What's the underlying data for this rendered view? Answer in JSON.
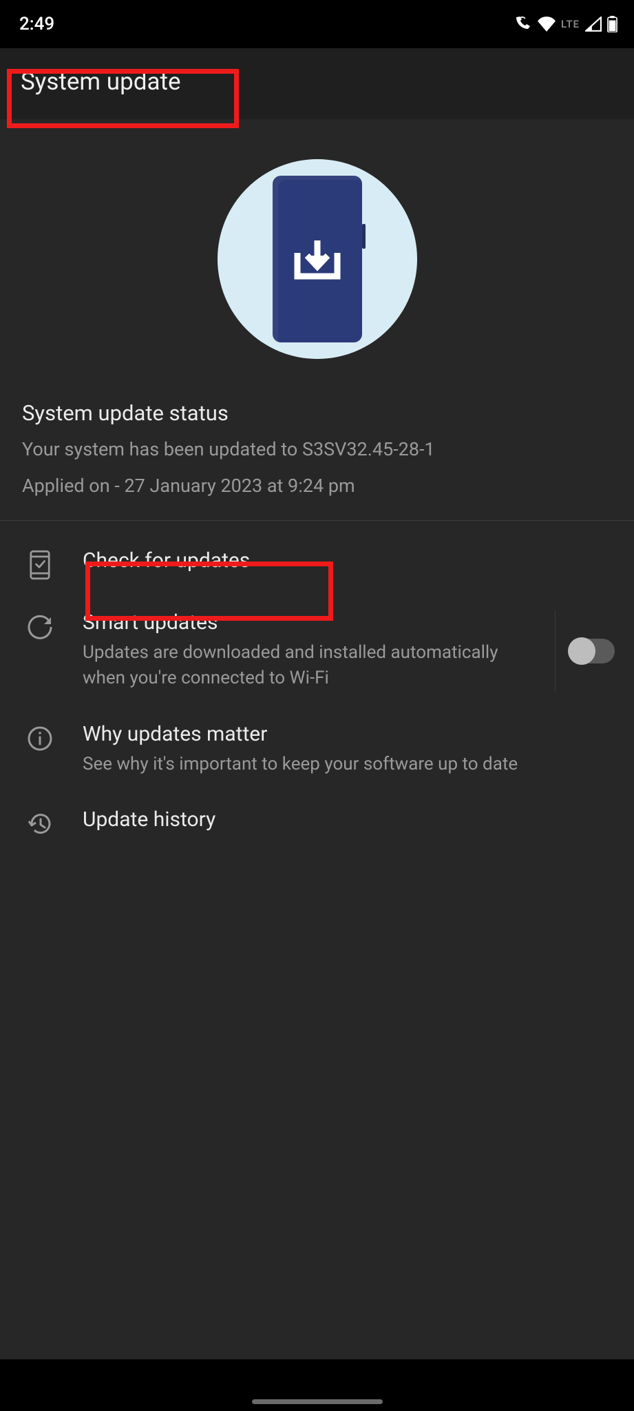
{
  "status_bar": {
    "time": "2:49",
    "network_type": "LTE"
  },
  "header": {
    "title": "System update"
  },
  "status_block": {
    "title": "System update status",
    "line1": "Your system has been updated to S3SV32.45-28-1",
    "line2": "Applied on - 27 January 2023 at 9:24 pm"
  },
  "rows": {
    "check": {
      "title": "Check for updates"
    },
    "smart": {
      "title": "Smart updates",
      "sub": "Updates are downloaded and installed automatically when you're connected to Wi-Fi",
      "enabled": false
    },
    "why": {
      "title": "Why updates matter",
      "sub": "See why it's important to keep your software up to date"
    },
    "history": {
      "title": "Update history"
    }
  }
}
